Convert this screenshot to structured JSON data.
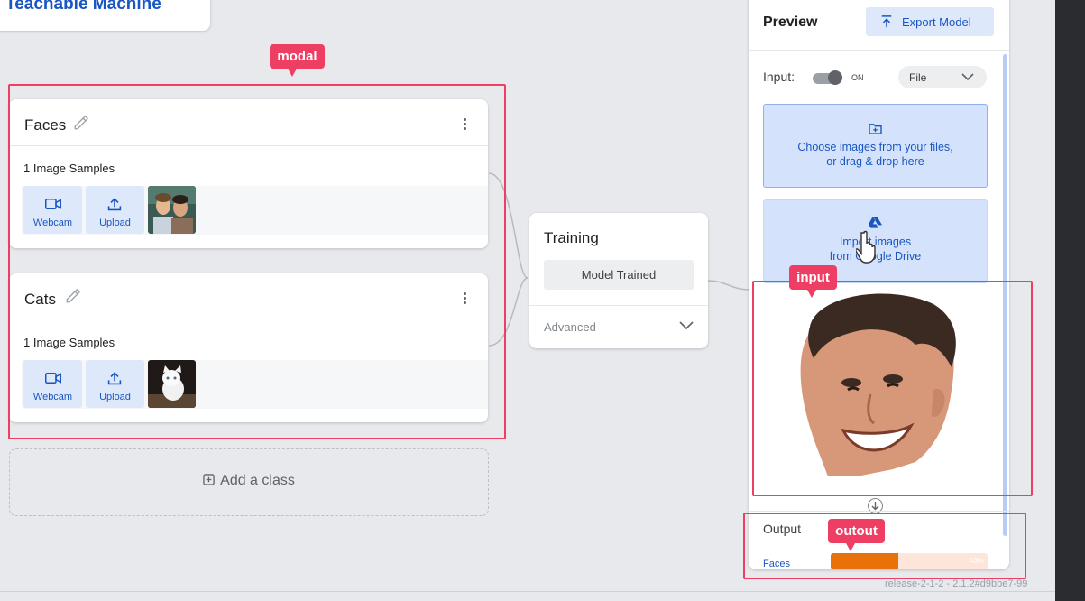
{
  "app": {
    "title": "Teachable Machine"
  },
  "classes": [
    {
      "name": "Faces",
      "samples_label": "1 Image Samples",
      "buttons": {
        "webcam": "Webcam",
        "upload": "Upload"
      }
    },
    {
      "name": "Cats",
      "samples_label": "1 Image Samples",
      "buttons": {
        "webcam": "Webcam",
        "upload": "Upload"
      }
    }
  ],
  "add_class_label": "Add a class",
  "training": {
    "title": "Training",
    "status_button": "Model Trained",
    "advanced_label": "Advanced"
  },
  "preview": {
    "title": "Preview",
    "export_label": "Export Model",
    "input_label": "Input:",
    "toggle_state": "ON",
    "source_select": "File",
    "choose_files_line1": "Choose images from your files,",
    "choose_files_line2": "or drag & drop here",
    "drive_line1": "Import images",
    "drive_line2": "from Google Drive",
    "output_label": "Output",
    "outputs": [
      {
        "class": "Faces",
        "percent_label": "43%",
        "percent": 43
      }
    ]
  },
  "annotations": {
    "modal": "modal",
    "input": "input",
    "output": "outout"
  },
  "version": "release-2-1-2 - 2.1.2#d9bbe7-99",
  "colors": {
    "accent": "#1a56c2",
    "annotation": "#ee3e64",
    "bar_fill": "#e8710a",
    "bar_bg": "#fde6d9",
    "button_bg": "#dde8fa"
  }
}
